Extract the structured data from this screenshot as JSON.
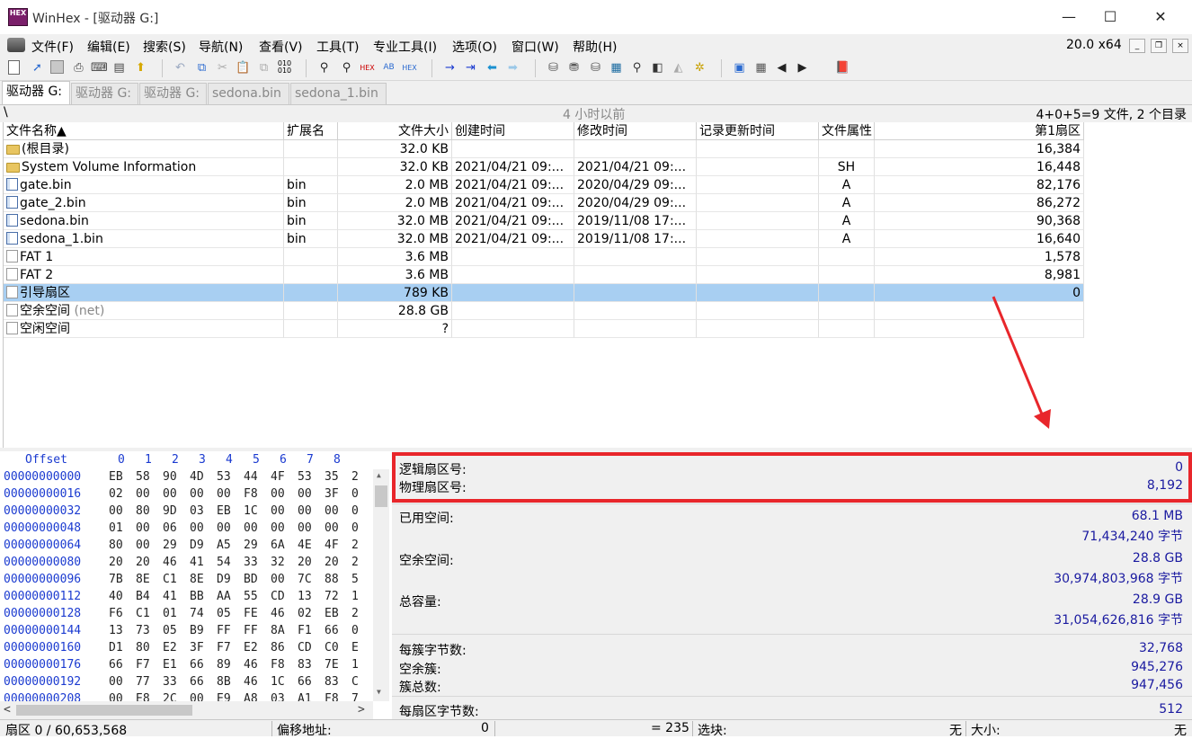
{
  "title": {
    "app_icon": "HEX",
    "window": "WinHex - [驱动器 G:]",
    "minimize": "—",
    "maximize": "☐",
    "close": "✕"
  },
  "menu": [
    "文件(F)",
    "编辑(E)",
    "搜索(S)",
    "导航(N)",
    "查看(V)",
    "工具(T)",
    "专业工具(I)",
    "选项(O)",
    "窗口(W)",
    "帮助(H)"
  ],
  "version": "20.0 x64",
  "mdi": {
    "min": "_",
    "restore": "❐",
    "close": "×"
  },
  "toolbar_icons": [
    "new-file-icon",
    "open-icon",
    "save-icon",
    "print-icon",
    "properties-icon",
    "clipboard-icon",
    "export-icon",
    "undo-icon",
    "copy-icon",
    "cut-icon",
    "paste-icon",
    "paste-special-icon",
    "hex-convert-icon",
    "find-icon",
    "find-text-icon",
    "find-hex-icon",
    "replace-text-icon",
    "replace-hex-icon",
    "goto-offset-icon",
    "goto-sector-icon",
    "back-icon",
    "forward-icon",
    "disk-icon",
    "ram-icon",
    "disk-edit-icon",
    "calculator-icon",
    "zoom-icon",
    "clone-icon",
    "image-icon",
    "settings-icon",
    "grid-icon",
    "table-icon",
    "prev-icon",
    "next-icon",
    "help-book-icon"
  ],
  "tabs": [
    "驱动器 G:",
    "驱动器 G:",
    "驱动器 G:",
    "sedona.bin",
    "sedona_1.bin"
  ],
  "path": {
    "root": "\\",
    "time": "4 小时以前",
    "summary": "4+0+5=9 文件, 2 个目录"
  },
  "columns": [
    "文件名称▲",
    "扩展名",
    "文件大小",
    "创建时间",
    "修改时间",
    "记录更新时间",
    "文件属性",
    "第1扇区"
  ],
  "rows": [
    {
      "icon": "folder",
      "name": "(根目录)",
      "ext": "",
      "size": "32.0 KB",
      "created": "",
      "modified": "",
      "updated": "",
      "attr": "",
      "sector": "16,384"
    },
    {
      "icon": "folder",
      "name": "System Volume Information",
      "ext": "",
      "size": "32.0 KB",
      "created": "2021/04/21  09:...",
      "modified": "2021/04/21  09:...",
      "updated": "",
      "attr": "SH",
      "sector": "16,448"
    },
    {
      "icon": "file",
      "name": "gate.bin",
      "ext": "bin",
      "size": "2.0 MB",
      "created": "2021/04/21  09:...",
      "modified": "2020/04/29  09:...",
      "updated": "",
      "attr": "A",
      "sector": "82,176"
    },
    {
      "icon": "file",
      "name": "gate_2.bin",
      "ext": "bin",
      "size": "2.0 MB",
      "created": "2021/04/21  09:...",
      "modified": "2020/04/29  09:...",
      "updated": "",
      "attr": "A",
      "sector": "86,272"
    },
    {
      "icon": "file",
      "name": "sedona.bin",
      "ext": "bin",
      "size": "32.0 MB",
      "created": "2021/04/21  09:...",
      "modified": "2019/11/08  17:...",
      "updated": "",
      "attr": "A",
      "sector": "90,368"
    },
    {
      "icon": "file",
      "name": "sedona_1.bin",
      "ext": "bin",
      "size": "32.0 MB",
      "created": "2021/04/21  09:...",
      "modified": "2019/11/08  17:...",
      "updated": "",
      "attr": "A",
      "sector": "16,640"
    },
    {
      "icon": "doc",
      "name": "FAT 1",
      "ext": "",
      "size": "3.6 MB",
      "created": "",
      "modified": "",
      "updated": "",
      "attr": "",
      "sector": "1,578"
    },
    {
      "icon": "doc",
      "name": "FAT 2",
      "ext": "",
      "size": "3.6 MB",
      "created": "",
      "modified": "",
      "updated": "",
      "attr": "",
      "sector": "8,981"
    },
    {
      "icon": "doc",
      "name": "引导扇区",
      "ext": "",
      "size": "789 KB",
      "created": "",
      "modified": "",
      "updated": "",
      "attr": "",
      "sector": "0",
      "selected": true
    },
    {
      "icon": "doc",
      "name": "空余空间",
      "note": "(net)",
      "ext": "",
      "size": "28.8 GB",
      "created": "",
      "modified": "",
      "updated": "",
      "attr": "",
      "sector": ""
    },
    {
      "icon": "doc",
      "name": "空闲空间",
      "ext": "",
      "size": "?",
      "created": "",
      "modified": "",
      "updated": "",
      "attr": "",
      "sector": ""
    }
  ],
  "hex": {
    "header_offset": "Offset",
    "header_cols": [
      "0",
      "1",
      "2",
      "3",
      "4",
      "5",
      "6",
      "7",
      "8"
    ],
    "rows": [
      {
        "offset": "00000000000",
        "bytes": [
          "EB",
          "58",
          "90",
          "4D",
          "53",
          "44",
          "4F",
          "53",
          "35",
          "2"
        ]
      },
      {
        "offset": "00000000016",
        "bytes": [
          "02",
          "00",
          "00",
          "00",
          "00",
          "F8",
          "00",
          "00",
          "3F",
          "0"
        ]
      },
      {
        "offset": "00000000032",
        "bytes": [
          "00",
          "80",
          "9D",
          "03",
          "EB",
          "1C",
          "00",
          "00",
          "00",
          "0"
        ]
      },
      {
        "offset": "00000000048",
        "bytes": [
          "01",
          "00",
          "06",
          "00",
          "00",
          "00",
          "00",
          "00",
          "00",
          "0"
        ]
      },
      {
        "offset": "00000000064",
        "bytes": [
          "80",
          "00",
          "29",
          "D9",
          "A5",
          "29",
          "6A",
          "4E",
          "4F",
          "2"
        ]
      },
      {
        "offset": "00000000080",
        "bytes": [
          "20",
          "20",
          "46",
          "41",
          "54",
          "33",
          "32",
          "20",
          "20",
          "2"
        ]
      },
      {
        "offset": "00000000096",
        "bytes": [
          "7B",
          "8E",
          "C1",
          "8E",
          "D9",
          "BD",
          "00",
          "7C",
          "88",
          "5"
        ]
      },
      {
        "offset": "00000000112",
        "bytes": [
          "40",
          "B4",
          "41",
          "BB",
          "AA",
          "55",
          "CD",
          "13",
          "72",
          "1"
        ]
      },
      {
        "offset": "00000000128",
        "bytes": [
          "F6",
          "C1",
          "01",
          "74",
          "05",
          "FE",
          "46",
          "02",
          "EB",
          "2"
        ]
      },
      {
        "offset": "00000000144",
        "bytes": [
          "13",
          "73",
          "05",
          "B9",
          "FF",
          "FF",
          "8A",
          "F1",
          "66",
          "0"
        ]
      },
      {
        "offset": "00000000160",
        "bytes": [
          "D1",
          "80",
          "E2",
          "3F",
          "F7",
          "E2",
          "86",
          "CD",
          "C0",
          "E"
        ]
      },
      {
        "offset": "00000000176",
        "bytes": [
          "66",
          "F7",
          "E1",
          "66",
          "89",
          "46",
          "F8",
          "83",
          "7E",
          "1"
        ]
      },
      {
        "offset": "00000000192",
        "bytes": [
          "00",
          "77",
          "33",
          "66",
          "8B",
          "46",
          "1C",
          "66",
          "83",
          "C"
        ]
      },
      {
        "offset": "00000000208",
        "bytes": [
          "00",
          "E8",
          "2C",
          "00",
          "E9",
          "A8",
          "03",
          "A1",
          "F8",
          "7"
        ]
      }
    ],
    "scroll_up": "▲",
    "scroll_down": "▼",
    "scroll_left": "<",
    "scroll_right": ">"
  },
  "info": {
    "logical_sector": {
      "label": "逻辑扇区号:",
      "value": "0"
    },
    "physical_sector": {
      "label": "物理扇区号:",
      "value": "8,192"
    },
    "used_space": {
      "label": "已用空间:",
      "value1": "68.1 MB",
      "value2": "71,434,240 字节"
    },
    "free_space": {
      "label": "空余空间:",
      "value1": "28.8 GB",
      "value2": "30,974,803,968 字节"
    },
    "total": {
      "label": "总容量:",
      "value1": "28.9 GB",
      "value2": "31,054,626,816 字节"
    },
    "bytes_per_cluster": {
      "label": "每簇字节数:",
      "value": "32,768"
    },
    "free_clusters": {
      "label": "空余簇:",
      "value": "945,276"
    },
    "total_clusters": {
      "label": "簇总数:",
      "value": "947,456"
    },
    "bytes_per_sector": {
      "label": "每扇区字节数:",
      "value": "512"
    }
  },
  "status": {
    "sector": "扇区 0 / 60,653,568",
    "offset_label": "偏移地址:",
    "offset_value": "0",
    "eq": "= 235",
    "sel_label": "选块:",
    "sel_value": "无",
    "size_label": "大小:",
    "size_value": "无"
  },
  "colors": {
    "highlight_box": "#e8262b",
    "arrow": "#e8262b",
    "selection": "#a8cff2",
    "value_blue": "#1a1aa0",
    "offset_blue": "#1a3ad0"
  }
}
